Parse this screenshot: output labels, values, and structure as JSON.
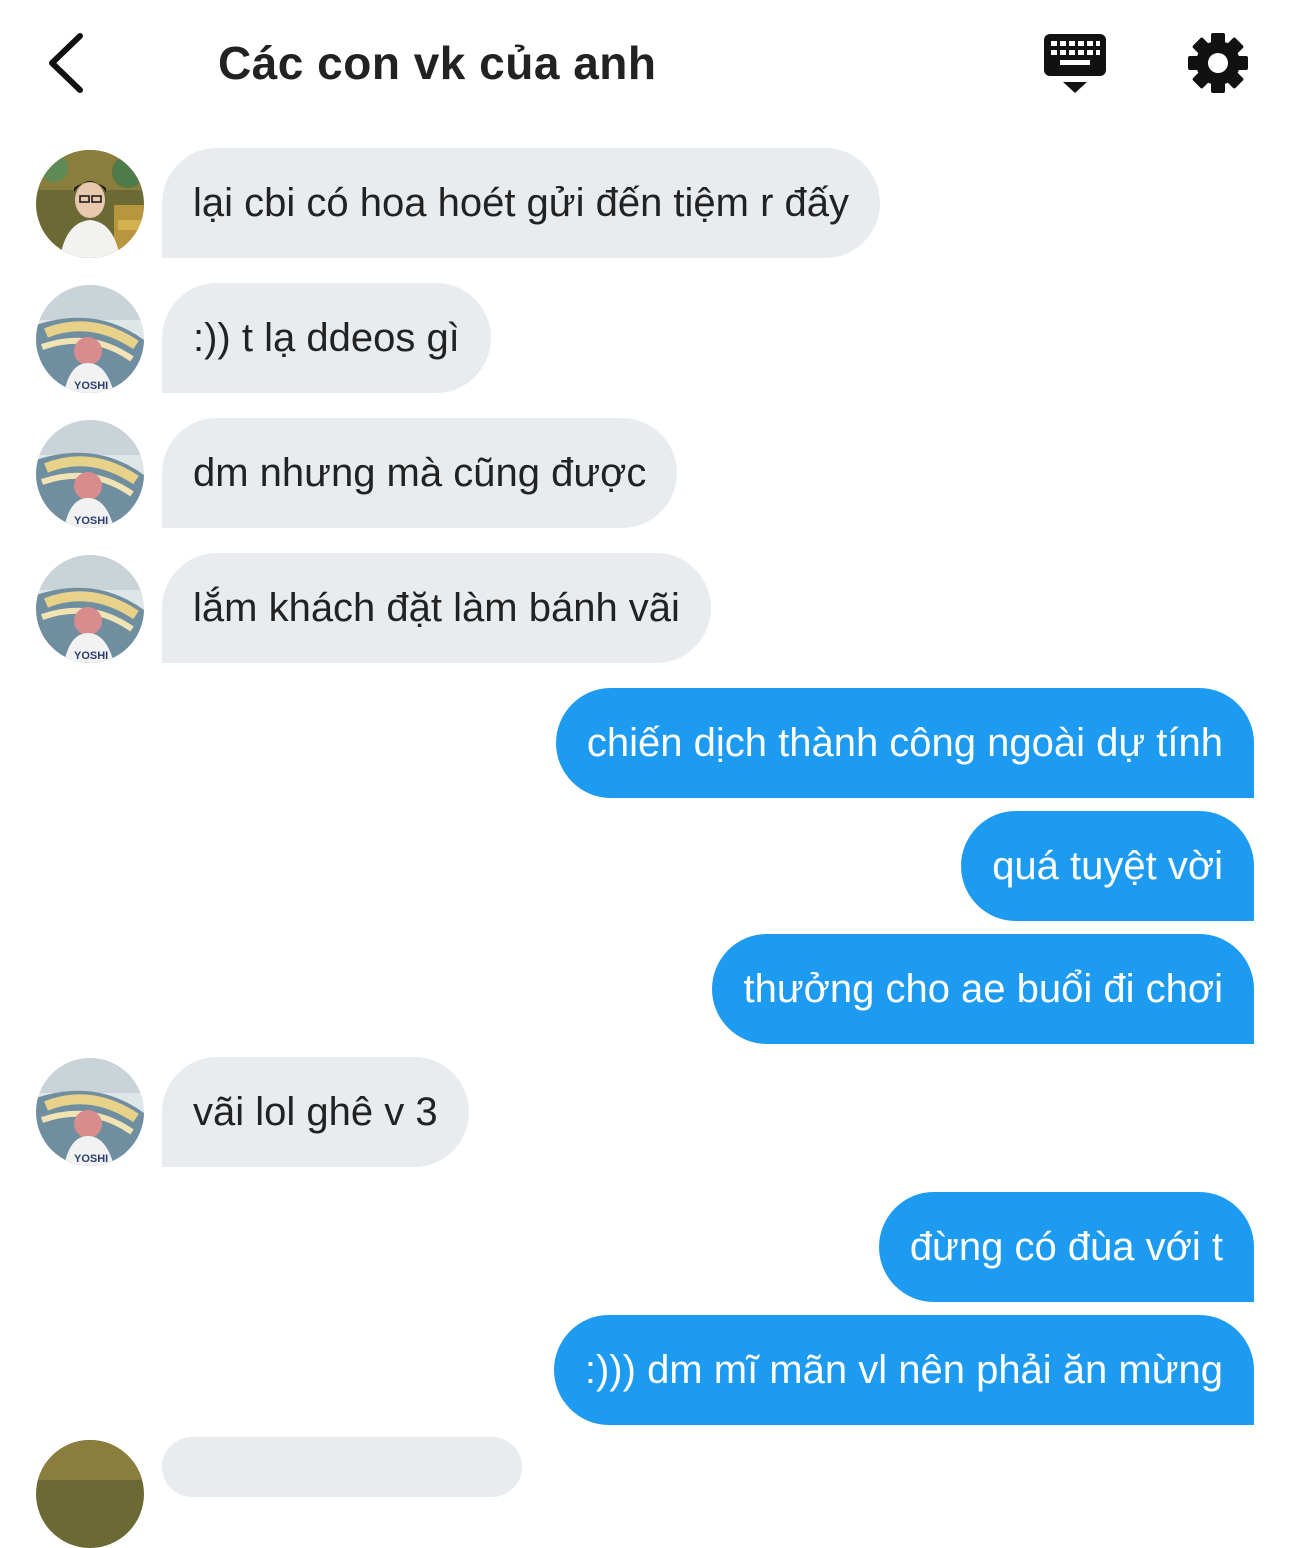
{
  "header": {
    "title": "Các con vk của anh",
    "back_icon": "chevron-left-icon",
    "keyboard_icon": "keyboard-hide-icon",
    "settings_icon": "gear-icon"
  },
  "avatar_labels": {
    "yoshi": "YOSHI"
  },
  "messages": [
    {
      "side": "in",
      "text": "lại cbi có hoa hoét gửi đến tiệm r đấy"
    },
    {
      "side": "in",
      "text": ":)) t lạ ddeos gì"
    },
    {
      "side": "in",
      "text": "dm nhưng mà cũng được"
    },
    {
      "side": "in",
      "text": "lắm khách đặt làm bánh vãi"
    },
    {
      "side": "out",
      "text": "chiến dịch thành công ngoài dự tính"
    },
    {
      "side": "out",
      "text": "quá tuyệt vời"
    },
    {
      "side": "out",
      "text": "thưởng cho ae buổi đi chơi"
    },
    {
      "side": "in",
      "text": "vãi lol ghê v 3"
    },
    {
      "side": "out",
      "text": "đừng có đùa với t"
    },
    {
      "side": "out",
      "text": ":))) dm mĩ mãn vl nên phải ăn mừng"
    }
  ],
  "colors": {
    "outgoing_bubble": "#1d9bf0",
    "incoming_bubble": "#e9ecef",
    "text_dark": "#222222"
  }
}
